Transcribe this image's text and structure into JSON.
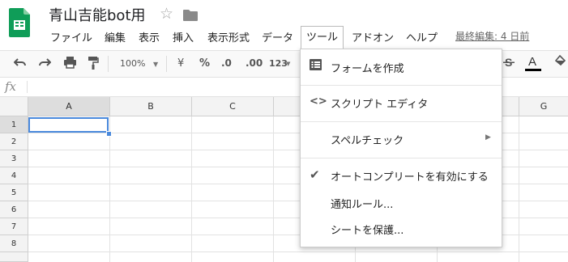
{
  "document": {
    "title": "青山吉能bot用"
  },
  "menubar": {
    "items": [
      "ファイル",
      "編集",
      "表示",
      "挿入",
      "表示形式",
      "データ",
      "ツール",
      "アドオン",
      "ヘルプ"
    ],
    "last_edit": "最終編集: 4 日前"
  },
  "toolbar": {
    "zoom": "100%",
    "currency": "¥",
    "percent": "%",
    "decrease_decimal": ".0",
    "increase_decimal": ".00",
    "more_formats": "123"
  },
  "formula_bar": {
    "label": "fx",
    "value": ""
  },
  "grid": {
    "columns": [
      "A",
      "B",
      "C",
      "G"
    ],
    "rows": [
      "1",
      "2",
      "3",
      "4",
      "5",
      "6",
      "7",
      "8"
    ]
  },
  "tools_menu": {
    "items": [
      {
        "label": "フォームを作成",
        "icon": "form-icon"
      },
      {
        "label": "スクリプト エディタ",
        "icon": "code-icon"
      },
      {
        "label": "スペルチェック",
        "icon": "submenu-arrow-icon"
      },
      {
        "label": "オートコンプリートを有効にする",
        "icon": "check-icon"
      },
      {
        "label": "通知ルール..."
      },
      {
        "label": "シートを保護..."
      }
    ]
  },
  "colors": {
    "selection": "#4a89dc",
    "logo_green": "#0f9d58"
  }
}
